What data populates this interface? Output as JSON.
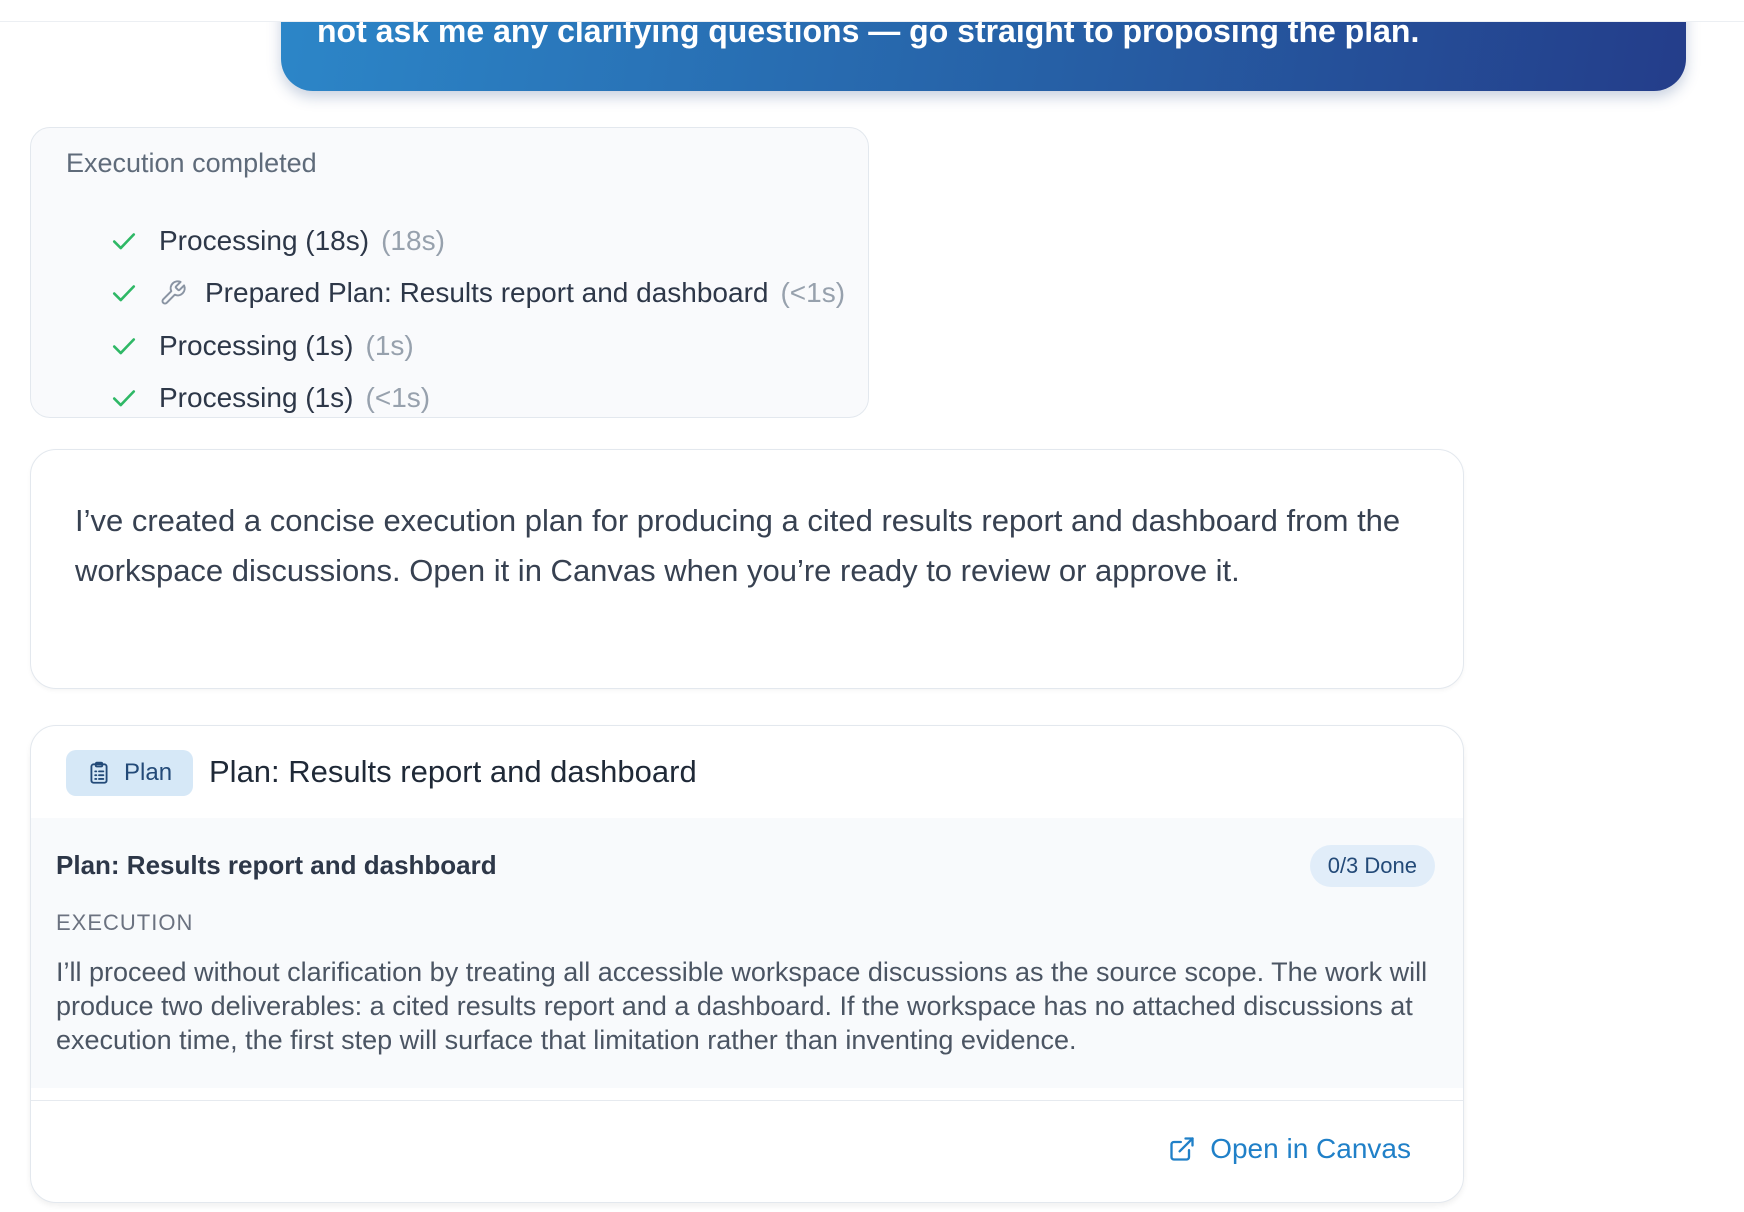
{
  "user_message": {
    "text": "not ask me any clarifying questions — go straight to proposing the plan."
  },
  "execution": {
    "title": "Execution completed",
    "steps": [
      {
        "label": "Processing (18s)",
        "duration": "(18s)",
        "icon": "check-icon"
      },
      {
        "label": "Prepared Plan: Results report and dashboard",
        "duration": "(<1s)",
        "icon": "check-icon",
        "tool_icon": "wrench-icon"
      },
      {
        "label": "Processing (1s)",
        "duration": "(1s)",
        "icon": "check-icon"
      },
      {
        "label": "Processing (1s)",
        "duration": "(<1s)",
        "icon": "check-icon"
      }
    ]
  },
  "assistant_message": {
    "text": "I’ve created a concise execution plan for producing a cited results report and dashboard from the workspace discussions. Open it in Canvas when you’re ready to review or approve it."
  },
  "plan": {
    "badge_label": "Plan",
    "badge_icon": "clipboard-icon",
    "header_title": "Plan: Results report and dashboard",
    "body_title": "Plan: Results report and dashboard",
    "progress": "0/3 Done",
    "section_label": "EXECUTION",
    "section_text": "I’ll proceed without clarification by treating all accessible workspace discussions as the source scope. The work will produce two deliverables: a cited results report and a dashboard. If the workspace has no attached discussions at execution time, the first step will surface that limitation rather than inventing evidence.",
    "open_label": "Open in Canvas",
    "open_icon": "external-link-icon"
  },
  "colors": {
    "accent": "#2080c8",
    "check": "#2fb866",
    "bubble_gradient_start": "#2c86c8",
    "bubble_gradient_end": "#243d8a"
  }
}
